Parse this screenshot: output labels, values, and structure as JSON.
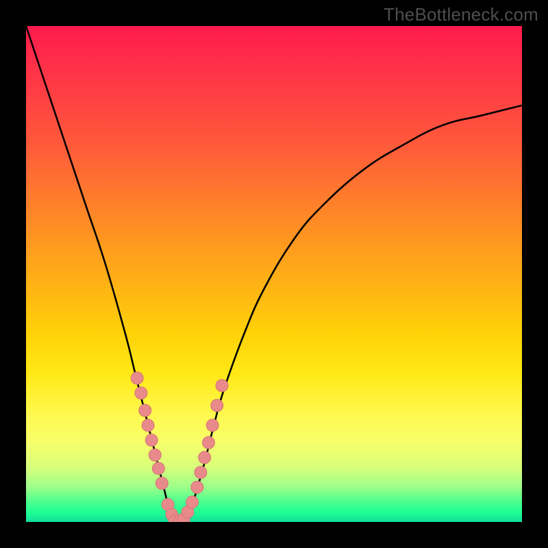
{
  "watermark": "TheBottleneck.com",
  "colors": {
    "frame": "#000000",
    "curve": "#000000",
    "point_fill": "#e98a8a",
    "point_stroke": "#d47575",
    "watermark_text": "#4e4e4e"
  },
  "chart_data": {
    "type": "line",
    "title": "",
    "xlabel": "",
    "ylabel": "",
    "xlim": [
      0,
      100
    ],
    "ylim": [
      0,
      100
    ],
    "grid": false,
    "legend": false,
    "series": [
      {
        "name": "bottleneck-curve",
        "x": [
          0,
          4,
          8,
          12,
          16,
          20,
          22,
          24,
          26,
          28,
          29,
          30,
          31,
          32,
          33,
          34,
          36,
          38,
          40,
          44,
          48,
          54,
          60,
          68,
          76,
          84,
          92,
          100
        ],
        "y": [
          100,
          88,
          76,
          64,
          52,
          38,
          30,
          22,
          14,
          6,
          2,
          0,
          0,
          0,
          2,
          5,
          12,
          20,
          27,
          38,
          47,
          57,
          64,
          71,
          76,
          80,
          82,
          84
        ]
      }
    ],
    "points_overlay": {
      "name": "marked-points",
      "x": [
        22.4,
        23.2,
        24.0,
        24.6,
        25.3,
        26.0,
        26.7,
        27.4,
        28.6,
        29.4,
        30.0,
        31.0,
        31.8,
        32.6,
        33.5,
        34.5,
        35.2,
        36.0,
        36.8,
        37.6,
        38.5,
        39.5
      ],
      "y": [
        29.0,
        26.0,
        22.5,
        19.5,
        16.5,
        13.5,
        10.8,
        7.8,
        3.5,
        1.5,
        0.2,
        0.2,
        0.6,
        2.0,
        4.0,
        7.0,
        10.0,
        13.0,
        16.0,
        19.5,
        23.5,
        27.5
      ]
    }
  }
}
